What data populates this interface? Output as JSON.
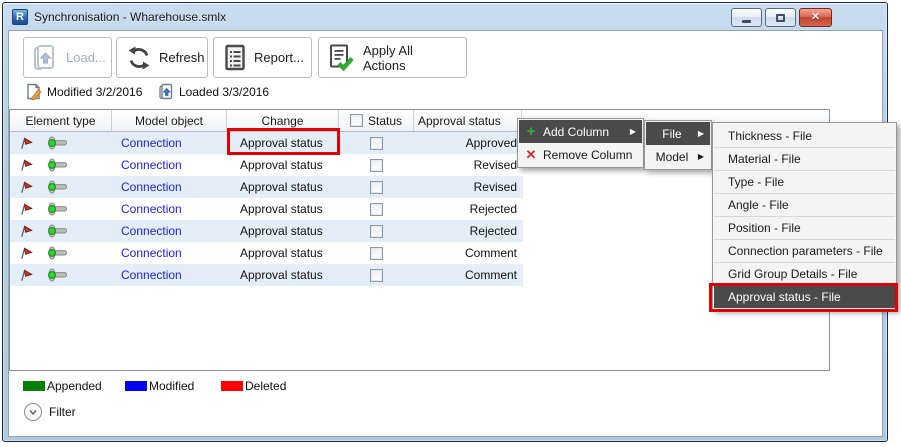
{
  "window": {
    "title": "Synchronisation - Wharehouse.smlx",
    "logo_letter": "R"
  },
  "toolbar": {
    "buttons": [
      {
        "label": "Load...",
        "icon": "load-icon",
        "disabled": true
      },
      {
        "label": "Refresh",
        "icon": "refresh-icon",
        "disabled": false
      },
      {
        "label": "Report...",
        "icon": "report-icon",
        "disabled": false
      },
      {
        "label": "Apply All Actions",
        "icon": "apply-all-actions-icon",
        "disabled": false
      }
    ]
  },
  "status_info": {
    "modified": "Modified 3/2/2016",
    "loaded": "Loaded 3/3/2016"
  },
  "table": {
    "headers": {
      "element_type": "Element type",
      "model_object": "Model object",
      "change": "Change",
      "status": "Status",
      "approval_status": "Approval status"
    },
    "rows": [
      {
        "model_object": "Connection",
        "change": "Approval status",
        "status_checked": false,
        "approval_status": "Approved"
      },
      {
        "model_object": "Connection",
        "change": "Approval status",
        "status_checked": false,
        "approval_status": "Revised"
      },
      {
        "model_object": "Connection",
        "change": "Approval status",
        "status_checked": false,
        "approval_status": "Revised"
      },
      {
        "model_object": "Connection",
        "change": "Approval status",
        "status_checked": false,
        "approval_status": "Rejected"
      },
      {
        "model_object": "Connection",
        "change": "Approval status",
        "status_checked": false,
        "approval_status": "Rejected"
      },
      {
        "model_object": "Connection",
        "change": "Approval status",
        "status_checked": false,
        "approval_status": "Comment"
      },
      {
        "model_object": "Connection",
        "change": "Approval status",
        "status_checked": false,
        "approval_status": "Comment"
      }
    ]
  },
  "context_menu": {
    "add_column": "Add Column",
    "remove_column": "Remove Column"
  },
  "column_source_menu": {
    "file": "File",
    "model": "Model"
  },
  "file_columns_menu": {
    "items": [
      "Thickness - File",
      "Material - File",
      "Type - File",
      "Angle - File",
      "Position - File",
      "Connection parameters - File",
      "Grid Group Details - File",
      "Approval status - File"
    ],
    "highlighted_item": "Approval status - File"
  },
  "legend": {
    "appended": {
      "label": "Appended",
      "color": "#007f00"
    },
    "modified": {
      "label": "Modified",
      "color": "#0000ee"
    },
    "deleted": {
      "label": "Deleted",
      "color": "#fe0000"
    }
  },
  "filter": {
    "label": "Filter"
  },
  "annotation": {
    "highlight_color": "#e00000"
  }
}
